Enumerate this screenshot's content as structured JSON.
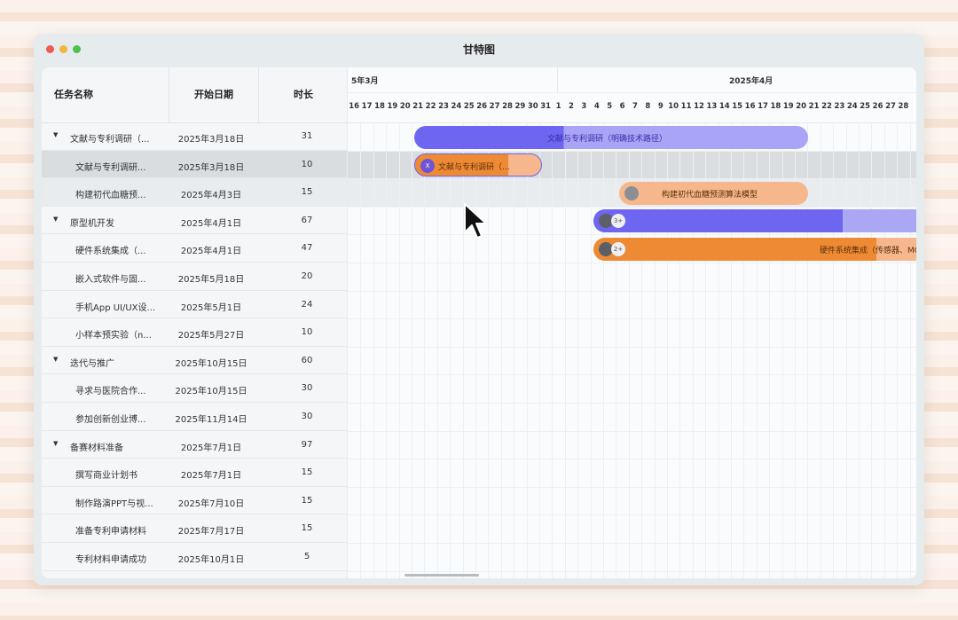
{
  "window": {
    "title": "甘特图"
  },
  "table": {
    "headers": {
      "name": "任务名称",
      "start": "开始日期",
      "duration": "时长"
    },
    "rows": [
      {
        "name": "文献与专利调研（...",
        "start": "2025年3月18日",
        "duration": "31",
        "level": 0
      },
      {
        "name": "文献与专利调研...",
        "start": "2025年3月18日",
        "duration": "10",
        "level": 1
      },
      {
        "name": "构建初代血糖预...",
        "start": "2025年4月3日",
        "duration": "15",
        "level": 1
      },
      {
        "name": "原型机开发",
        "start": "2025年4月1日",
        "duration": "67",
        "level": 0
      },
      {
        "name": "硬件系统集成（...",
        "start": "2025年4月1日",
        "duration": "47",
        "level": 1
      },
      {
        "name": "嵌入式软件与固...",
        "start": "2025年5月18日",
        "duration": "20",
        "level": 1
      },
      {
        "name": "手机App UI/UX设...",
        "start": "2025年5月1日",
        "duration": "24",
        "level": 1
      },
      {
        "name": "小样本预实验（n...",
        "start": "2025年5月27日",
        "duration": "10",
        "level": 1
      },
      {
        "name": "迭代与推广",
        "start": "2025年10月15日",
        "duration": "60",
        "level": 0
      },
      {
        "name": "寻求与医院合作...",
        "start": "2025年10月15日",
        "duration": "30",
        "level": 1
      },
      {
        "name": "参加创新创业博...",
        "start": "2025年11月14日",
        "duration": "30",
        "level": 1
      },
      {
        "name": "备赛材料准备",
        "start": "2025年7月1日",
        "duration": "97",
        "level": 0
      },
      {
        "name": "撰写商业计划书",
        "start": "2025年7月1日",
        "duration": "15",
        "level": 1
      },
      {
        "name": "制作路演PPT与视...",
        "start": "2025年7月10日",
        "duration": "15",
        "level": 1
      },
      {
        "name": "准备专利申请材料",
        "start": "2025年7月17日",
        "duration": "15",
        "level": 1
      },
      {
        "name": "专利材料申请成功",
        "start": "2025年10月1日",
        "duration": "5",
        "level": 1
      }
    ]
  },
  "timeline": {
    "months": [
      {
        "label": "5年3月"
      },
      {
        "label": "2025年4月"
      }
    ],
    "days": [
      "16",
      "17",
      "18",
      "19",
      "20",
      "21",
      "22",
      "23",
      "24",
      "25",
      "26",
      "27",
      "28",
      "29",
      "30",
      "31",
      "1",
      "2",
      "3",
      "4",
      "5",
      "6",
      "7",
      "8",
      "9",
      "10",
      "11",
      "12",
      "13",
      "14",
      "15",
      "16",
      "17",
      "18",
      "19",
      "20",
      "21",
      "22",
      "23",
      "24",
      "25",
      "26",
      "27",
      "28"
    ],
    "bars": [
      {
        "label": "文献与专利调研（明确技术路径）",
        "color": "#6e65f0",
        "light": "#a9a4f6",
        "progress": 0.38
      },
      {
        "label": "文献与专利调研（...",
        "color": "#ee8a33",
        "light": "#f6b78c",
        "progress": 0.74,
        "avatar": "X"
      },
      {
        "label": "构建初代血糖预测算法模型",
        "color": "#ee8a33",
        "light": "#f6b78c",
        "progress": 0.0
      },
      {
        "label": "",
        "color": "#6e65f0",
        "light": "#aaa7f5",
        "progress": 0.74,
        "plus": "3+"
      },
      {
        "label": "硬件系统集成（传感器、MCU、蓝牙",
        "color": "#ee8a33",
        "light": "#f6b78c",
        "progress": 0.84,
        "plus": "2+"
      }
    ]
  }
}
